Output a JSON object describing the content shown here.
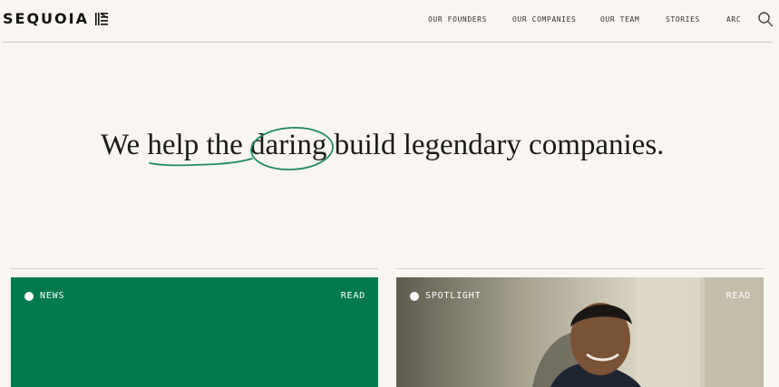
{
  "brand": {
    "name": "SEQUOIA"
  },
  "nav": {
    "items": [
      {
        "label": "OUR FOUNDERS"
      },
      {
        "label": "OUR COMPANIES"
      },
      {
        "label": "OUR TEAM"
      },
      {
        "label": "STORIES"
      },
      {
        "label": "ARC"
      }
    ],
    "search_icon": "search-icon"
  },
  "hero": {
    "part1": "We ",
    "underlined": "help the",
    "space": " ",
    "circled": "daring",
    "part2": " build legendary companies.",
    "accent_color": "#1f8a5e"
  },
  "cards": [
    {
      "tag": "NEWS",
      "action": "READ",
      "bg": "#007a4d"
    },
    {
      "tag": "SPOTLIGHT",
      "action": "READ",
      "bg": "#b9b3a3"
    }
  ]
}
